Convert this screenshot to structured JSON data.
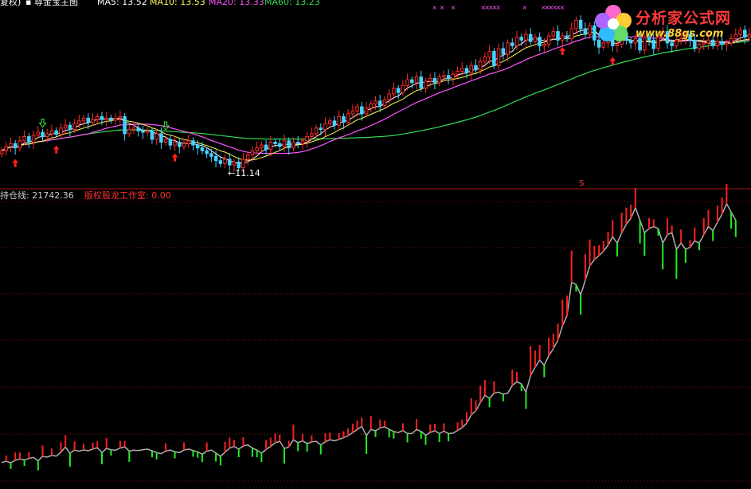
{
  "top_bar": {
    "item1": "复权)",
    "item2": "▪ 尊金宝主图",
    "ma_a": "MA5: 13.52",
    "ma_b": "MA10: 13.53",
    "ma_c": "MA20: 13.33",
    "ma_d": "MA60: 13.23"
  },
  "lower_panel": {
    "holding_label": "持仓线: 21742.36",
    "studio_label": "版权股龙工作室: 0.00"
  },
  "annotations": {
    "low_price": "←11.14",
    "s_mark": "S"
  },
  "watermark": {
    "line1": "分析家公式网",
    "line2": "www.88gs.com"
  },
  "colors": {
    "background": "#000000",
    "up": "#ff2a2a",
    "down": "#44d3ff",
    "ma5": "#ffffff",
    "ma10": "#ffff55",
    "ma20": "#ff55ff",
    "ma60": "#33dd55",
    "holding_up": "#ff2020",
    "holding_down": "#22ee22",
    "holding_line": "#b0b0b0",
    "grid": "#8a1010"
  },
  "chart_data": [
    {
      "type": "candlestick",
      "title": "尊金宝主图",
      "series_names": [
        "MA5",
        "MA10",
        "MA20",
        "MA60"
      ],
      "ylim": [
        10.6,
        17.0
      ],
      "close": [
        11.8,
        11.95,
        12.05,
        11.9,
        12.15,
        12.3,
        12.1,
        12.35,
        12.45,
        12.3,
        12.4,
        12.5,
        12.38,
        12.6,
        12.7,
        12.55,
        12.75,
        12.85,
        12.95,
        12.8,
        12.9,
        13.0,
        12.9,
        12.95,
        12.88,
        12.95,
        13.0,
        12.4,
        12.55,
        12.6,
        12.5,
        12.45,
        12.5,
        12.2,
        12.4,
        12.1,
        12.2,
        12.0,
        12.1,
        11.95,
        12.05,
        12.15,
        12.0,
        11.9,
        11.8,
        11.7,
        11.6,
        11.45,
        11.35,
        11.5,
        11.3,
        11.4,
        11.2,
        11.5,
        11.65,
        11.8,
        11.9,
        12.0,
        11.85,
        12.1,
        12.05,
        11.95,
        12.15,
        11.9,
        12.1,
        12.05,
        12.15,
        12.3,
        12.4,
        12.6,
        12.55,
        12.75,
        12.85,
        12.7,
        13.0,
        12.8,
        13.1,
        13.2,
        13.35,
        13.1,
        13.3,
        13.45,
        13.55,
        13.4,
        13.6,
        13.8,
        14.0,
        13.85,
        14.1,
        14.3,
        14.2,
        14.4,
        14.0,
        14.25,
        14.35,
        14.2,
        14.4,
        14.45,
        14.35,
        14.5,
        14.6,
        14.7,
        14.55,
        14.8,
        14.65,
        14.95,
        15.1,
        15.3,
        14.8,
        15.4,
        15.2,
        15.6,
        15.5,
        15.8,
        15.7,
        15.9,
        15.65,
        15.8,
        15.5,
        15.55,
        15.85,
        16.0,
        15.7,
        15.85,
        15.75,
        16.1,
        16.4,
        16.1,
        15.9,
        16.2,
        15.7,
        15.45,
        15.6,
        15.8,
        15.5,
        15.55,
        15.95,
        15.7,
        15.6,
        15.75,
        15.35,
        15.8,
        15.7,
        15.4,
        15.8,
        16.0,
        15.6,
        15.5,
        15.7,
        15.75,
        15.9,
        15.7,
        15.4,
        15.55,
        15.6,
        15.7,
        15.5,
        15.65,
        15.55,
        15.6,
        15.75,
        15.9,
        16.05,
        15.8,
        15.9
      ],
      "holding_line": [
        3700,
        3760,
        3690,
        3810,
        3880,
        3820,
        3900,
        3950,
        3780,
        4000,
        3960,
        4050,
        4010,
        4200,
        4450,
        4150,
        4300,
        4250,
        4310,
        4270,
        4350,
        4420,
        4180,
        4380,
        4320,
        4300,
        4400,
        4460,
        4250,
        4300,
        4280,
        4320,
        4350,
        4270,
        4180,
        4130,
        4250,
        4300,
        4220,
        4180,
        4300,
        4350,
        4280,
        4220,
        4100,
        4250,
        4300,
        4160,
        4000,
        4200,
        4400,
        4480,
        4350,
        4500,
        4550,
        4400,
        4300,
        4150,
        4330,
        4480,
        4650,
        4730,
        4380,
        4450,
        4800,
        4660,
        4750,
        4620,
        4700,
        4720,
        4550,
        4700,
        4800,
        4750,
        4820,
        4900,
        5000,
        5150,
        5300,
        5450,
        5000,
        5300,
        5230,
        5370,
        5430,
        5300,
        5200,
        5150,
        5250,
        5100,
        5100,
        5300,
        5200,
        5020,
        5150,
        5240,
        5100,
        5220,
        5100,
        5120,
        5250,
        5380,
        5600,
        6000,
        6200,
        6600,
        6950,
        6800,
        7050,
        7100,
        7000,
        7050,
        7420,
        7600,
        7500,
        7100,
        7900,
        8300,
        8650,
        8400,
        8850,
        9200,
        9600,
        10300,
        10800,
        12400,
        12300,
        11800,
        12500,
        13200,
        13500,
        13700,
        13900,
        14200,
        14600,
        14300,
        14800,
        15200,
        15500,
        16000,
        15400,
        14800,
        15000,
        15100,
        15000,
        14300,
        14700,
        14800,
        14000,
        14300,
        14000,
        14100,
        14400,
        14300,
        14700,
        15100,
        14900,
        15300,
        15700,
        16200,
        15800,
        15400
      ]
    }
  ]
}
